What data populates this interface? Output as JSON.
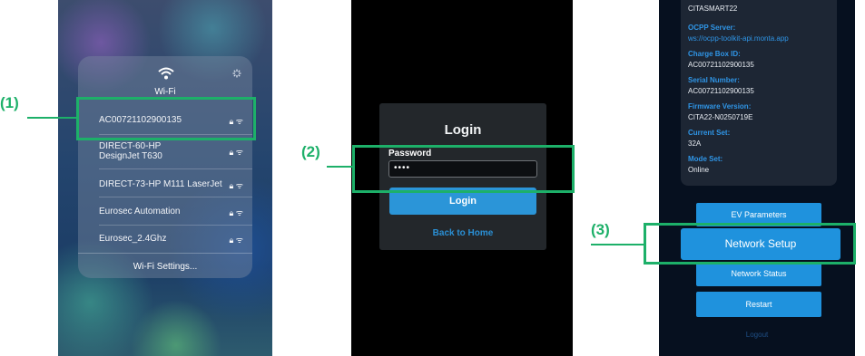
{
  "callouts": {
    "c1": "(1)",
    "c2": "(2)",
    "c3": "(3)"
  },
  "colors": {
    "accent": "#1db069",
    "button": "#1f92dd",
    "link": "#2f95e6"
  },
  "wifi": {
    "title": "Wi-Fi",
    "networks": [
      {
        "name": "AC00721102900135"
      },
      {
        "name_line1": "DIRECT-60-HP",
        "name_line2": "DesignJet T630"
      },
      {
        "name": "DIRECT-73-HP M111 LaserJet"
      },
      {
        "name": "Eurosec Automation"
      },
      {
        "name": "Eurosec_2.4Ghz"
      }
    ],
    "settings_label": "Wi-Fi Settings..."
  },
  "login": {
    "title": "Login",
    "password_label": "Password",
    "password_value": "••••",
    "login_button": "Login",
    "back_link": "Back to Home"
  },
  "status": {
    "top_value": "CITASMART22",
    "ocpp_label": "OCPP Server:",
    "ocpp_value": "ws://ocpp-toolkit-api.monta.app",
    "chargebox_label": "Charge Box ID:",
    "chargebox_value": "AC00721102900135",
    "serial_label": "Serial Number:",
    "serial_value": "AC00721102900135",
    "firmware_label": "Firmware Version:",
    "firmware_value": "CITA22-N0250719E",
    "current_label": "Current Set:",
    "current_value": "32A",
    "mode_label": "Mode Set:",
    "mode_value": "Online",
    "buttons": {
      "ev_parameters": "EV Parameters",
      "network_setup": "Network Setup",
      "network_status": "Network Status",
      "restart": "Restart"
    },
    "logout": "Logout"
  }
}
